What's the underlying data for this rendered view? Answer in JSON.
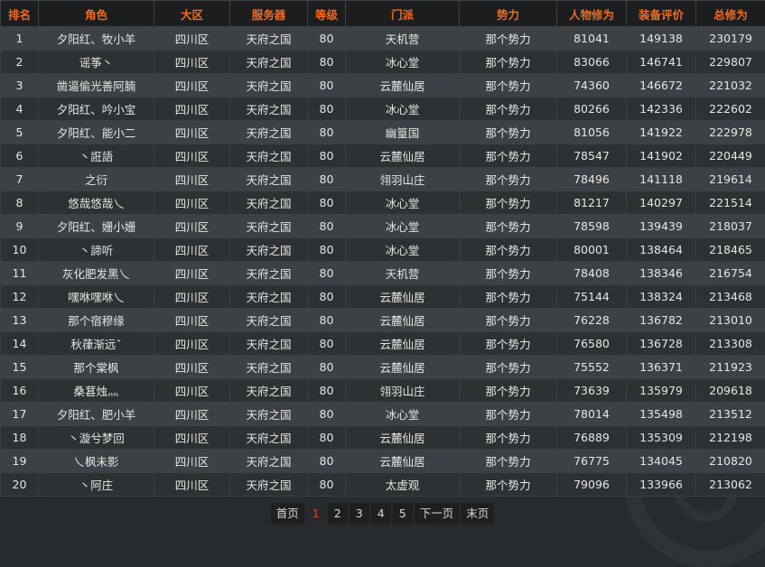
{
  "headers": [
    "排名",
    "角色",
    "大区",
    "服务器",
    "等级",
    "门派",
    "势力",
    "人物修为",
    "装备评价",
    "总修为"
  ],
  "rows": [
    [
      "1",
      "夕阳红、牧小羊",
      "四川区",
      "天府之国",
      "80",
      "天机营",
      "那个势力",
      "81041",
      "149138",
      "230179"
    ],
    [
      "2",
      "谣筝丶",
      "四川区",
      "天府之国",
      "80",
      "冰心堂",
      "那个势力",
      "83066",
      "146741",
      "229807"
    ],
    [
      "3",
      "凿逼偷光善阿腩",
      "四川区",
      "天府之国",
      "80",
      "云麓仙居",
      "那个势力",
      "74360",
      "146672",
      "221032"
    ],
    [
      "4",
      "夕阳红、吟小宝",
      "四川区",
      "天府之国",
      "80",
      "冰心堂",
      "那个势力",
      "80266",
      "142336",
      "222602"
    ],
    [
      "5",
      "夕阳红、能小二",
      "四川区",
      "天府之国",
      "80",
      "幽篁国",
      "那个势力",
      "81056",
      "141922",
      "222978"
    ],
    [
      "6",
      "丶誑語",
      "四川区",
      "天府之国",
      "80",
      "云麓仙居",
      "那个势力",
      "78547",
      "141902",
      "220449"
    ],
    [
      "7",
      "之衍",
      "四川区",
      "天府之国",
      "80",
      "翎羽山庄",
      "那个势力",
      "78496",
      "141118",
      "219614"
    ],
    [
      "8",
      "悠哉悠哉乀",
      "四川区",
      "天府之国",
      "80",
      "冰心堂",
      "那个势力",
      "81217",
      "140297",
      "221514"
    ],
    [
      "9",
      "夕阳红、姗小姗",
      "四川区",
      "天府之国",
      "80",
      "冰心堂",
      "那个势力",
      "78598",
      "139439",
      "218037"
    ],
    [
      "10",
      "丶諦听",
      "四川区",
      "天府之国",
      "80",
      "冰心堂",
      "那个势力",
      "80001",
      "138464",
      "218465"
    ],
    [
      "11",
      "灰化肥发黑乀",
      "四川区",
      "天府之国",
      "80",
      "天机营",
      "那个势力",
      "78408",
      "138346",
      "216754"
    ],
    [
      "12",
      "嘿咻嘿咻乀",
      "四川区",
      "天府之国",
      "80",
      "云麓仙居",
      "那个势力",
      "75144",
      "138324",
      "213468"
    ],
    [
      "13",
      "那个宿穆缘",
      "四川区",
      "天府之国",
      "80",
      "云麓仙居",
      "那个势力",
      "76228",
      "136782",
      "213010"
    ],
    [
      "14",
      "秋葎渐远ˇ",
      "四川区",
      "天府之国",
      "80",
      "云麓仙居",
      "那个势力",
      "76580",
      "136728",
      "213308"
    ],
    [
      "15",
      "那个棠枫",
      "四川区",
      "天府之国",
      "80",
      "云麓仙居",
      "那个势力",
      "75552",
      "136371",
      "211923"
    ],
    [
      "16",
      "桑葚烛灬",
      "四川区",
      "天府之国",
      "80",
      "翎羽山庄",
      "那个势力",
      "73639",
      "135979",
      "209618"
    ],
    [
      "17",
      "夕阳红、肥小羊",
      "四川区",
      "天府之国",
      "80",
      "冰心堂",
      "那个势力",
      "78014",
      "135498",
      "213512"
    ],
    [
      "18",
      "丶漩兮梦回",
      "四川区",
      "天府之国",
      "80",
      "云麓仙居",
      "那个势力",
      "76889",
      "135309",
      "212198"
    ],
    [
      "19",
      "乀枫未影",
      "四川区",
      "天府之国",
      "80",
      "云麓仙居",
      "那个势力",
      "76775",
      "134045",
      "210820"
    ],
    [
      "20",
      "丶阿庄",
      "四川区",
      "天府之国",
      "80",
      "太虚观",
      "那个势力",
      "79096",
      "133966",
      "213062"
    ]
  ],
  "pagination": {
    "first": "首页",
    "pages": [
      "1",
      "2",
      "3",
      "4",
      "5"
    ],
    "current": "1",
    "next": "下一页",
    "last": "末页"
  },
  "colors": {
    "header_text": "#f26b1c",
    "current_page": "#f23c28",
    "row_odd": "#3b4144",
    "row_even": "#2c3134"
  }
}
